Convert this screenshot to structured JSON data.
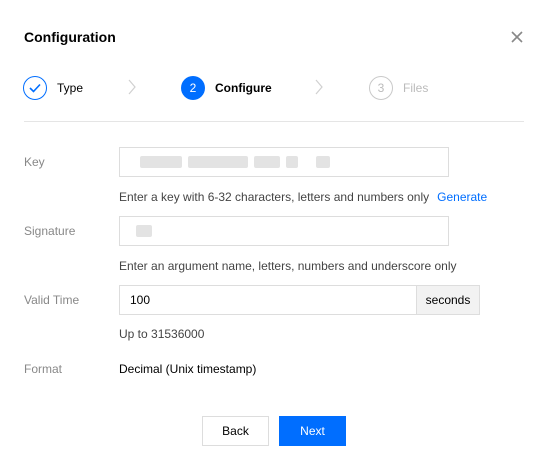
{
  "dialog": {
    "title": "Configuration",
    "close_icon": "close-icon"
  },
  "steps": [
    {
      "number": "1",
      "label": "Type",
      "state": "completed",
      "icon": "check-icon"
    },
    {
      "number": "2",
      "label": "Configure",
      "state": "active"
    },
    {
      "number": "3",
      "label": "Files",
      "state": "pending"
    }
  ],
  "form": {
    "key": {
      "label": "Key",
      "value_redacted": true,
      "hint": "Enter a key with 6-32 characters, letters and numbers only",
      "generate_link": "Generate"
    },
    "signature": {
      "label": "Signature",
      "value_redacted": true,
      "hint": "Enter an argument name, letters, numbers and underscore only"
    },
    "valid_time": {
      "label": "Valid Time",
      "value": "100",
      "unit": "seconds",
      "hint": "Up to 31536000"
    },
    "format": {
      "label": "Format",
      "value": "Decimal (Unix timestamp)"
    }
  },
  "footer": {
    "back_label": "Back",
    "next_label": "Next"
  },
  "colors": {
    "primary": "#006eff",
    "muted": "#888888",
    "border": "#dddddd"
  }
}
